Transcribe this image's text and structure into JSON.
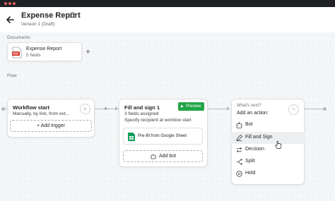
{
  "header": {
    "title": "Expense Report",
    "version": "Version 1 (Draft)"
  },
  "documents": {
    "section_label": "Documents",
    "items": [
      {
        "name": "Expense Report",
        "fields": "5 fields",
        "badge": "PDF"
      }
    ]
  },
  "flow": {
    "section_label": "Flow",
    "workflow_start": {
      "title": "Workflow start",
      "subtitle": "Manually, by link, from ext...",
      "add_trigger_label": "+ Add trigger"
    },
    "fill_and_sign": {
      "title": "Fill and sign 1",
      "fields_assigned": "3 fields assigned",
      "recipient_note": "Specify recipient at worklow start",
      "preview_label": "Preview",
      "prefill_label": "Pre-fill from Google Sheet",
      "add_bot_label": "Add bot"
    },
    "whats_next": {
      "hint": "What's next?",
      "title": "Add an action:",
      "options": [
        {
          "label": "Bot",
          "icon": "bot-icon",
          "active": false
        },
        {
          "label": "Fill and Sign",
          "icon": "pen-icon",
          "active": true
        },
        {
          "label": "Decision",
          "icon": "arrows-icon",
          "active": false
        },
        {
          "label": "Split",
          "icon": "split-icon",
          "active": false
        },
        {
          "label": "Hold",
          "icon": "hold-icon",
          "active": false
        }
      ]
    }
  },
  "colors": {
    "accent_green": "#22a447",
    "pdf_red": "#d93025",
    "sheet_green": "#0f9d58"
  }
}
